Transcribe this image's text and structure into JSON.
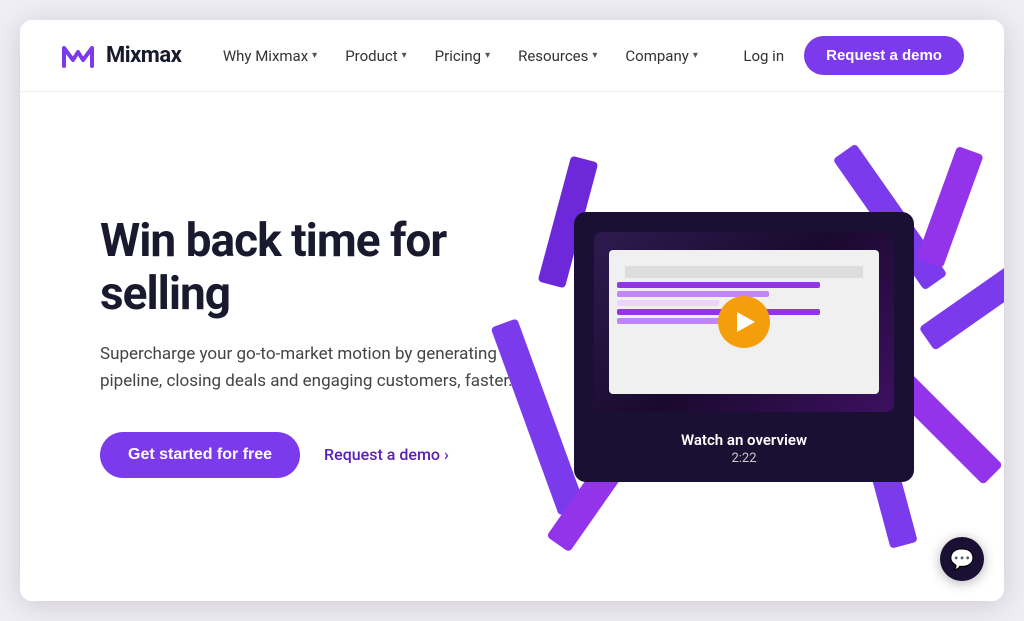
{
  "site": {
    "name": "Mixmax"
  },
  "header": {
    "logo_alt": "Mixmax logo",
    "nav_items": [
      {
        "label": "Why Mixmax",
        "has_dropdown": true
      },
      {
        "label": "Product",
        "has_dropdown": true
      },
      {
        "label": "Pricing",
        "has_dropdown": true
      },
      {
        "label": "Resources",
        "has_dropdown": true
      },
      {
        "label": "Company",
        "has_dropdown": true
      }
    ],
    "login_label": "Log in",
    "request_demo_label": "Request a demo"
  },
  "hero": {
    "title": "Win back time for selling",
    "subtitle": "Supercharge your go-to-market motion by generating pipeline, closing deals and engaging customers, faster.",
    "cta_primary": "Get started for free",
    "cta_secondary": "Request a demo",
    "cta_secondary_arrow": "›"
  },
  "video": {
    "title": "Watch an overview",
    "duration": "2:22",
    "play_label": "Play video"
  },
  "chat": {
    "icon": "💬"
  }
}
